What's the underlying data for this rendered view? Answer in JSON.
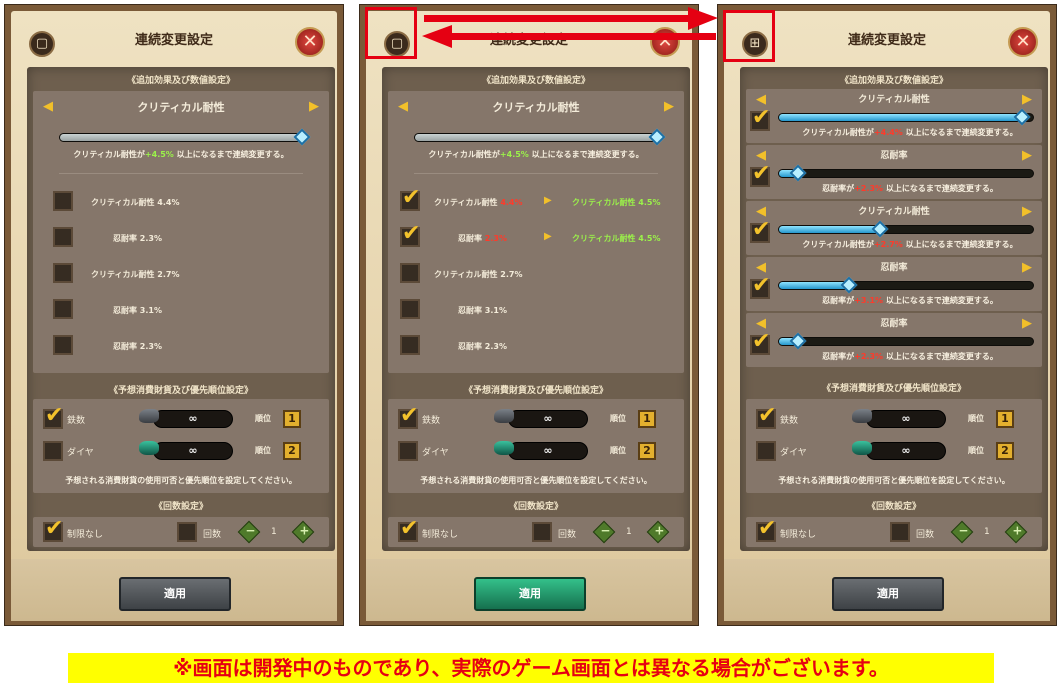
{
  "header": {
    "title": "連続変更設定",
    "close_glyph": "✕",
    "icon_a": "▢",
    "icon_b": "⊞"
  },
  "effect_section": {
    "title": "《追加効果及び数値設定》",
    "stat_name": "クリティカル耐性",
    "slider_fraction": 1.0,
    "desc_pre": "クリティカル耐性が",
    "desc_val": "+4.5%",
    "desc_post": " 以上になるまで連続変更する。",
    "options": [
      {
        "label": "クリティカル耐性 4.4%",
        "checked": false
      },
      {
        "label": "忍耐率 2.3%",
        "checked": false
      },
      {
        "label": "クリティカル耐性 2.7%",
        "checked": false
      },
      {
        "label": "忍耐率 3.1%",
        "checked": false
      },
      {
        "label": "忍耐率 2.3%",
        "checked": false
      }
    ],
    "options_panel2": [
      {
        "name": "クリティカル耐性 ",
        "value": "4.4%",
        "target": "クリティカル耐性 4.5%",
        "checked": true
      },
      {
        "name": "忍耐率 ",
        "value": "2.3%",
        "target": "クリティカル耐性 4.5%",
        "checked": true
      },
      {
        "name": "クリティカル耐性 2.7%",
        "value": "",
        "target": "",
        "checked": false
      },
      {
        "name": "忍耐率 3.1%",
        "value": "",
        "target": "",
        "checked": false
      },
      {
        "name": "忍耐率 2.3%",
        "value": "",
        "target": "",
        "checked": false
      }
    ],
    "multi_rows": [
      {
        "name": "クリティカル耐性",
        "desc_pre": "クリティカル耐性が",
        "desc_val": "+4.4%",
        "desc_post": " 以上になるまで連続変更する。",
        "fill": 0.96
      },
      {
        "name": "忍耐率",
        "desc_pre": "忍耐率が",
        "desc_val": "+2.3%",
        "desc_post": " 以上になるまで連続変更する。",
        "fill": 0.08
      },
      {
        "name": "クリティカル耐性",
        "desc_pre": "クリティカル耐性が",
        "desc_val": "+2.7%",
        "desc_post": " 以上になるまで連続変更する。",
        "fill": 0.4
      },
      {
        "name": "忍耐率",
        "desc_pre": "忍耐率が",
        "desc_val": "+3.1%",
        "desc_post": " 以上になるまで連続変更する。",
        "fill": 0.28
      },
      {
        "name": "忍耐率",
        "desc_pre": "忍耐率が",
        "desc_val": "+2.3%",
        "desc_post": " 以上になるまで連続変更する。",
        "fill": 0.08
      }
    ]
  },
  "cost_section": {
    "title": "《予想消費財貨及び優先順位設定》",
    "items": [
      {
        "name": "鉄数",
        "amount": "∞",
        "rank_label": "順位",
        "rank": "1",
        "checked": true,
        "icon": "anvil-icon"
      },
      {
        "name": "ダイヤ",
        "amount": "∞",
        "rank_label": "順位",
        "rank": "2",
        "checked": false,
        "icon": "gem-icon"
      }
    ],
    "note": "予想される消費財貨の使用可否と優先順位を設定してください。"
  },
  "count_section": {
    "title": "《回数設定》",
    "unlimited_label": "制限なし",
    "count_label": "回数",
    "count_value": "1",
    "minus": "−",
    "plus": "+"
  },
  "apply_label": "適用",
  "notice": "※画面は開発中のものであり、実際のゲーム画面とは異なる場合がございます。",
  "colors": {
    "accent_red": "#e50012",
    "notice_bg": "#ffff00",
    "apply_active": "#2aa876"
  }
}
